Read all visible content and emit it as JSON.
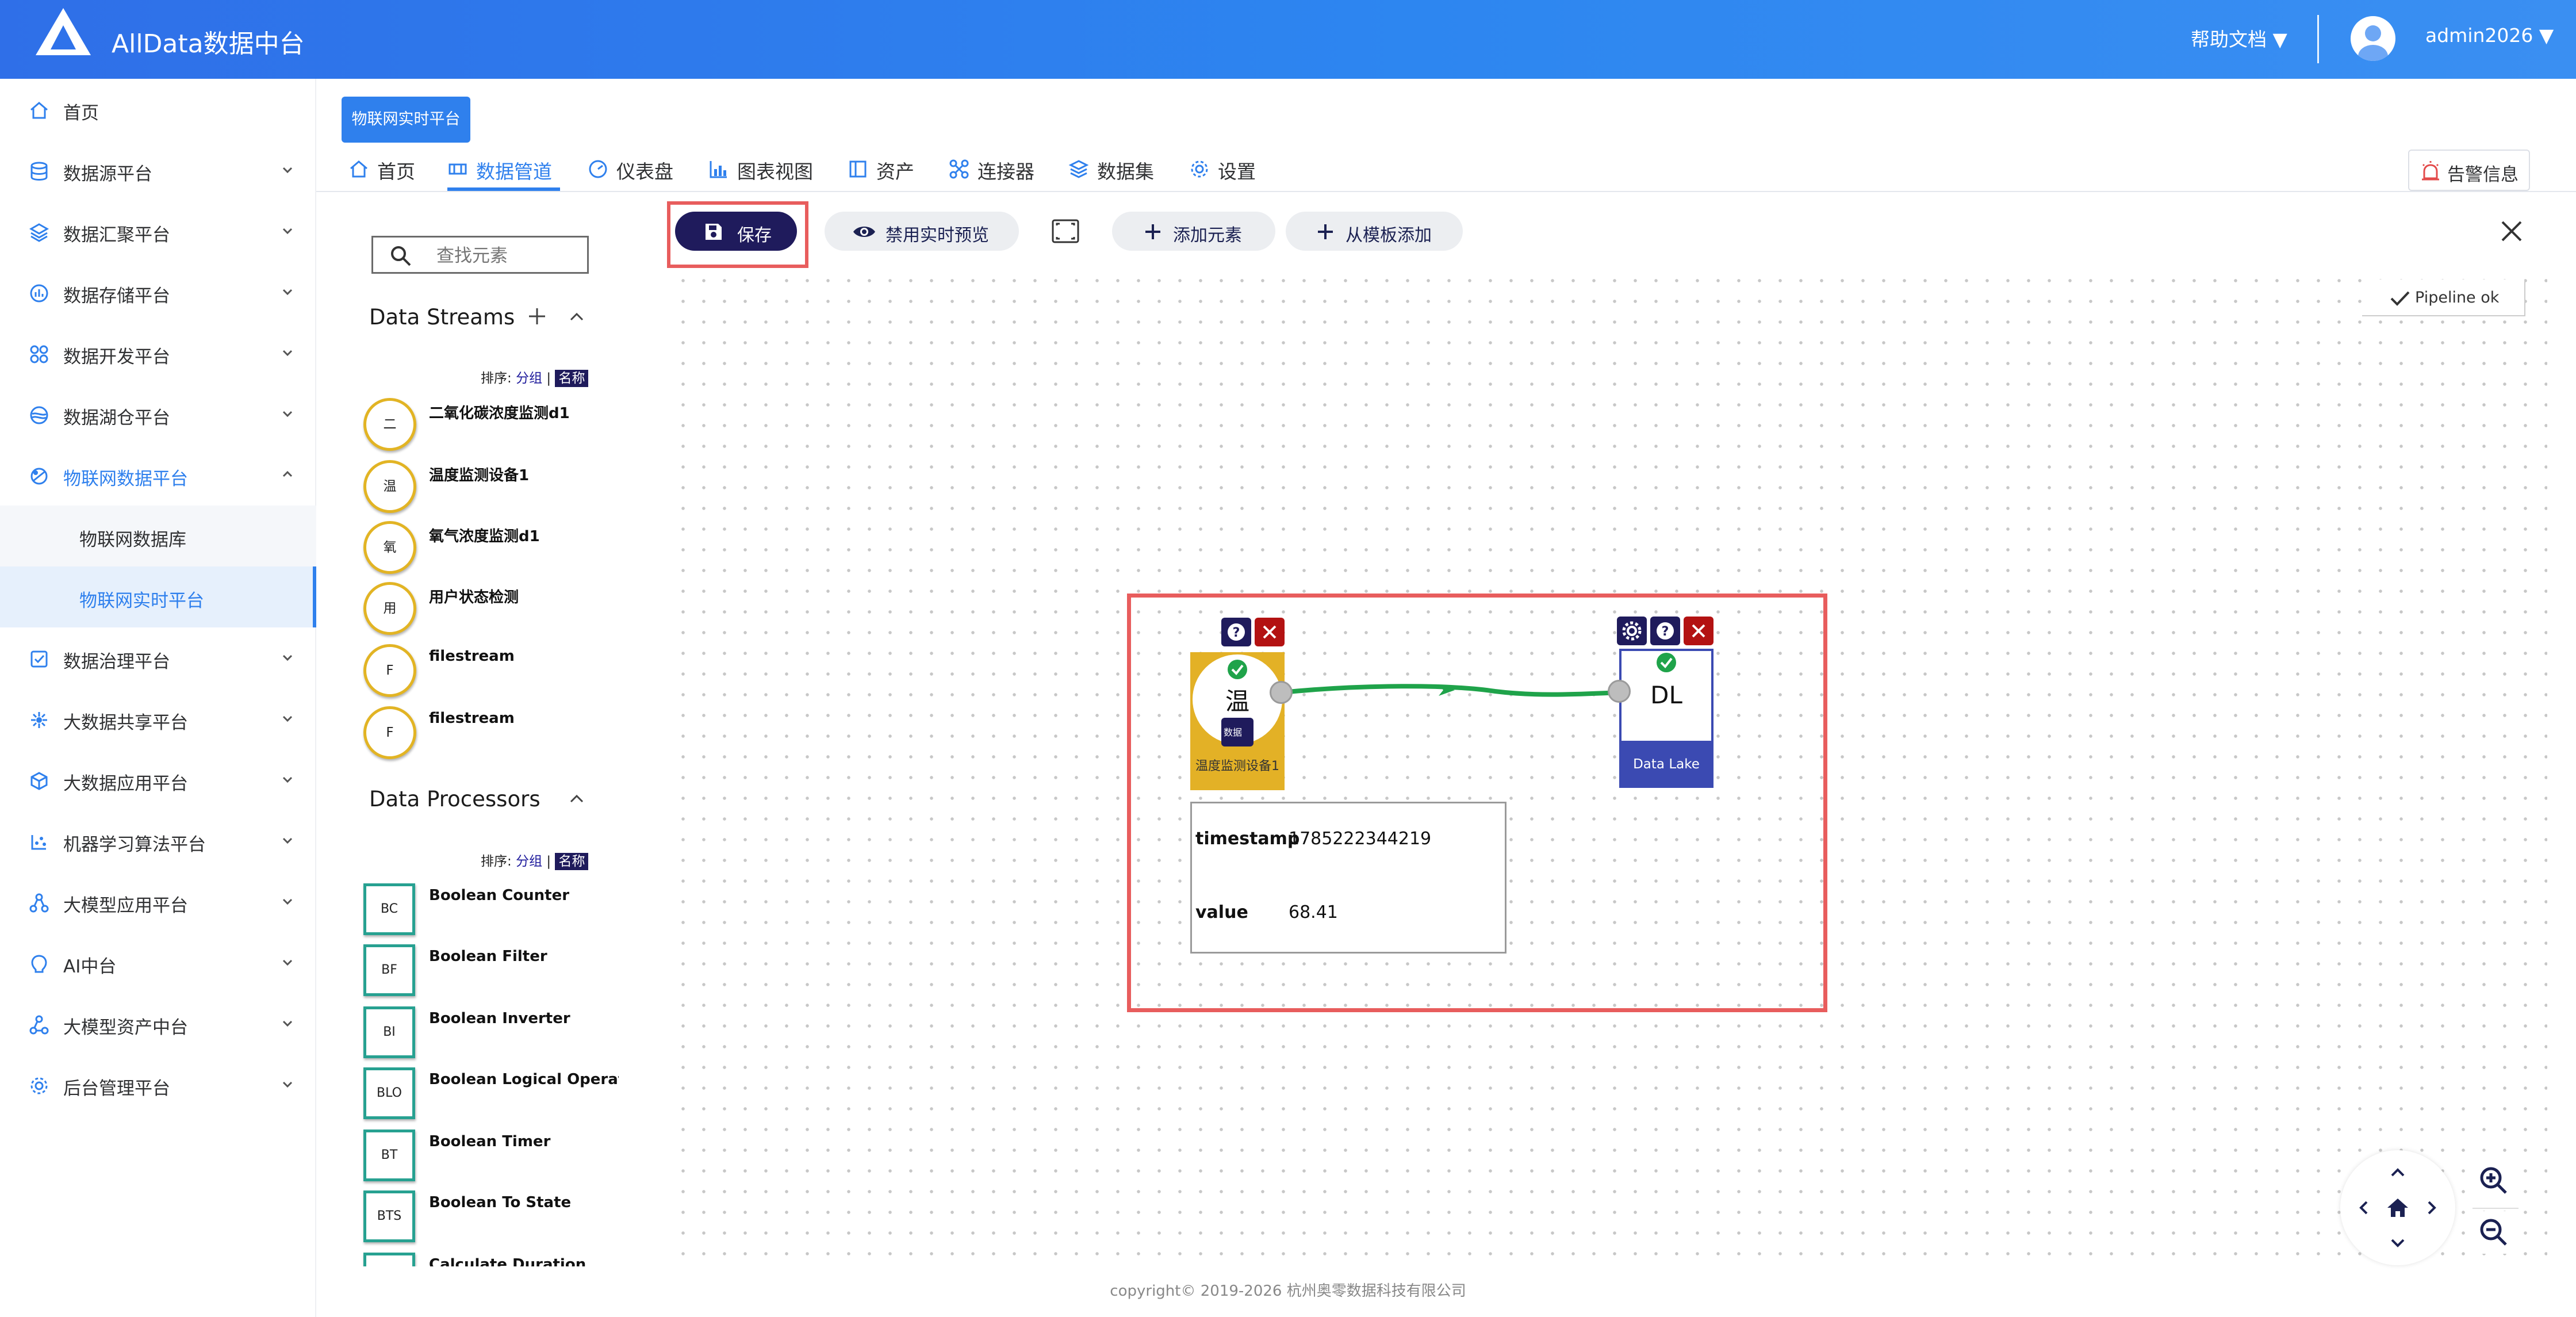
{
  "header": {
    "app_title": "AllData数据中台",
    "help_docs": "帮助文档 ▼",
    "user_name": "admin2026 ▼"
  },
  "sidebar": {
    "items": [
      {
        "label": "首页",
        "icon": "home-icon"
      },
      {
        "label": "数据源平台",
        "icon": "database-icon"
      },
      {
        "label": "数据汇聚平台",
        "icon": "layers-icon"
      },
      {
        "label": "数据存储平台",
        "icon": "chart-icon"
      },
      {
        "label": "数据开发平台",
        "icon": "grid-icon"
      },
      {
        "label": "数据湖仓平台",
        "icon": "lake-icon"
      },
      {
        "label": "物联网数据平台",
        "icon": "iot-icon"
      },
      {
        "label": "数据治理平台",
        "icon": "governance-icon"
      },
      {
        "label": "大数据共享平台",
        "icon": "share-icon"
      },
      {
        "label": "大数据应用平台",
        "icon": "cube-icon"
      },
      {
        "label": "机器学习算法平台",
        "icon": "ml-icon"
      },
      {
        "label": "大模型应用平台",
        "icon": "model-icon"
      },
      {
        "label": "AI中台",
        "icon": "ai-icon"
      },
      {
        "label": "大模型资产中台",
        "icon": "asset-icon"
      },
      {
        "label": "后台管理平台",
        "icon": "settings-icon"
      }
    ],
    "sub_items": [
      "物联网数据库",
      "物联网实时平台"
    ]
  },
  "page_tag": "物联网实时平台",
  "tabs": [
    {
      "label": "首页",
      "icon": "home-icon"
    },
    {
      "label": "数据管道",
      "icon": "pipeline-icon"
    },
    {
      "label": "仪表盘",
      "icon": "dashboard-icon"
    },
    {
      "label": "图表视图",
      "icon": "bar-chart-icon"
    },
    {
      "label": "资产",
      "icon": "asset-icon"
    },
    {
      "label": "连接器",
      "icon": "connector-icon"
    },
    {
      "label": "数据集",
      "icon": "dataset-icon"
    },
    {
      "label": "设置",
      "icon": "gear-icon"
    }
  ],
  "alert_button": "告警信息",
  "toolbar": {
    "save": "保存",
    "disable_preview": "禁用实时预览",
    "add_element": "添加元素",
    "add_from_template": "从模板添加"
  },
  "palette": {
    "search_placeholder": "查找元素",
    "streams_title": "Data Streams",
    "processors_title": "Data Processors",
    "sort_label": "排序:",
    "sort_group": "分组",
    "sort_name": "名称",
    "streams": [
      {
        "abbr": "二",
        "name": "二氧化碳浓度监测d1"
      },
      {
        "abbr": "温",
        "name": "温度监测设备1"
      },
      {
        "abbr": "氧",
        "name": "氧气浓度监测d1"
      },
      {
        "abbr": "用",
        "name": "用户状态检测"
      },
      {
        "abbr": "F",
        "name": "filestream"
      },
      {
        "abbr": "F",
        "name": "filestream"
      }
    ],
    "processors": [
      {
        "abbr": "BC",
        "name": "Boolean Counter"
      },
      {
        "abbr": "BF",
        "name": "Boolean Filter"
      },
      {
        "abbr": "BI",
        "name": "Boolean Inverter"
      },
      {
        "abbr": "BLO",
        "name": "Boolean Logical Operato"
      },
      {
        "abbr": "BT",
        "name": "Boolean Timer"
      },
      {
        "abbr": "BTS",
        "name": "Boolean To State"
      },
      {
        "abbr": "",
        "name": "Calculate Duration"
      }
    ]
  },
  "canvas": {
    "status": "Pipeline ok",
    "source": {
      "glyph": "温",
      "label": "温度监测设备1",
      "badge": "数据"
    },
    "sink": {
      "title": "DL",
      "label": "Data Lake"
    },
    "preview": [
      {
        "key": "timestamp",
        "value": "1785222344219"
      },
      {
        "key": "value",
        "value": "68.41"
      }
    ]
  },
  "colors": {
    "primary": "#2f80ed",
    "dark_navy": "#1f1b5c",
    "stream_yellow": "#e3b126",
    "processor_teal": "#27a191",
    "sink_blue": "#3b4ab2",
    "connection_green": "#1fa34a",
    "highlight_red": "#e85d5d"
  },
  "footer": {
    "copyright": "copyright© 2019-2026 杭州奥零数据科技有限公司"
  }
}
